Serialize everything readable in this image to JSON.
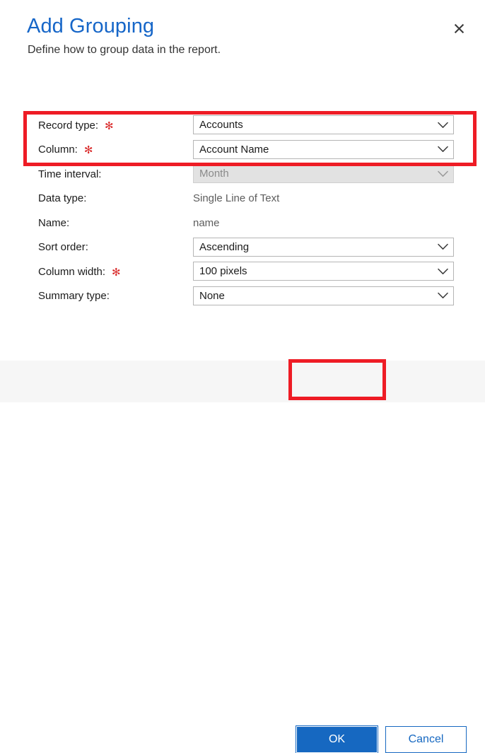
{
  "dialog": {
    "title": "Add Grouping",
    "subtitle": "Define how to group data in the report.",
    "close_icon": "close-icon"
  },
  "form": {
    "rows": [
      {
        "label": "Record type:",
        "required": true,
        "control": "dropdown",
        "value": "Accounts",
        "disabled": false
      },
      {
        "label": "Column:",
        "required": true,
        "control": "dropdown",
        "value": "Account Name",
        "disabled": false
      },
      {
        "label": "Time interval:",
        "required": false,
        "control": "dropdown",
        "value": "Month",
        "disabled": true
      },
      {
        "label": "Data type:",
        "required": false,
        "control": "static",
        "value": "Single Line of Text",
        "disabled": false
      },
      {
        "label": "Name:",
        "required": false,
        "control": "static",
        "value": "name",
        "disabled": false
      },
      {
        "label": "Sort order:",
        "required": false,
        "control": "dropdown",
        "value": "Ascending",
        "disabled": false
      },
      {
        "label": "Column width:",
        "required": true,
        "control": "dropdown",
        "value": "100 pixels",
        "disabled": false
      },
      {
        "label": "Summary type:",
        "required": false,
        "control": "dropdown",
        "value": "None",
        "disabled": false
      }
    ],
    "required_marker": "✻"
  },
  "footer": {
    "ok_label": "OK",
    "cancel_label": "Cancel"
  },
  "annotations": [
    {
      "name": "required-fields-highlight",
      "color": "#ee1c25"
    },
    {
      "name": "ok-button-highlight",
      "color": "#ee1c25"
    }
  ],
  "colors": {
    "title_blue": "#1666c8",
    "accent_blue": "#1668c1",
    "annotation_red": "#ee1c25",
    "required_red": "#d92b2b",
    "footer_bg": "#f6f6f6"
  }
}
